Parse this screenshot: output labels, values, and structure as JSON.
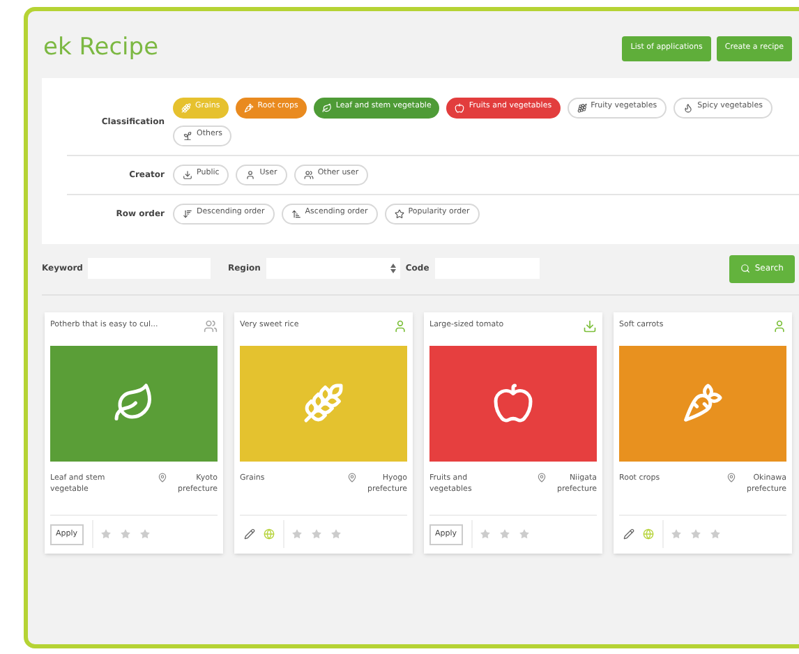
{
  "title": "ek Recipe",
  "header_buttons": [
    "List of applications",
    "Create a recipe"
  ],
  "filters": [
    {
      "label": "Classification",
      "chips": [
        {
          "label": "Grains",
          "selected": true,
          "color": "#e6c12e"
        },
        {
          "label": "Root crops",
          "selected": true,
          "color": "#e98a1f"
        },
        {
          "label": "Leaf and stem vegetable",
          "selected": true,
          "color": "#4e9b36"
        },
        {
          "label": "Fruits and vegetables",
          "selected": true,
          "color": "#e23d3d"
        },
        {
          "label": "Fruity vegetables",
          "selected": false
        },
        {
          "label": "Spicy vegetables",
          "selected": false
        },
        {
          "label": "Others",
          "selected": false
        }
      ]
    },
    {
      "label": "Creator",
      "chips": [
        {
          "label": "Public",
          "selected": false
        },
        {
          "label": "User",
          "selected": false
        },
        {
          "label": "Other user",
          "selected": false
        }
      ]
    },
    {
      "label": "Row order",
      "chips": [
        {
          "label": "Descending order",
          "selected": false
        },
        {
          "label": "Ascending order",
          "selected": false
        },
        {
          "label": "Popularity order",
          "selected": false
        }
      ]
    }
  ],
  "search": {
    "keyword_label": "Keyword",
    "region_label": "Region",
    "code_label": "Code",
    "button": "Search"
  },
  "cards": [
    {
      "kind": "apply",
      "title": "Potherb that is easy to cul...",
      "color": "#5a9e37",
      "category": "Leaf and stem vegetable",
      "location": "Kyoto prefecture",
      "apply_label": "Apply",
      "stars": 0
    },
    {
      "kind": "edit",
      "title": "Very sweet rice",
      "color": "#e4c22f",
      "category": "Grains",
      "location": "Hyogo prefecture",
      "stars": 0
    },
    {
      "kind": "apply",
      "title": "Large-sized tomato",
      "color": "#e63f3f",
      "category": "Fruits and vegetables",
      "location": "Niigata prefecture",
      "apply_label": "Apply",
      "stars": 0
    },
    {
      "kind": "edit",
      "title": "Soft carrots",
      "color": "#e8911f",
      "category": "Root crops",
      "location": "Okinawa prefecture",
      "stars": 0
    }
  ]
}
